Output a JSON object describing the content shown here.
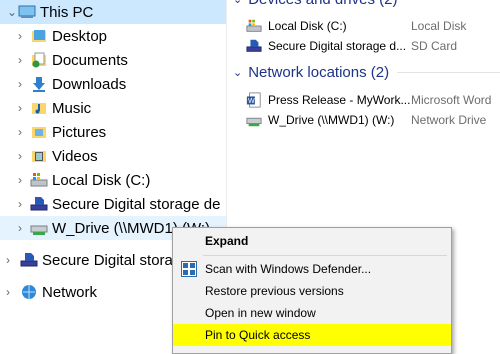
{
  "nav": {
    "items": [
      {
        "label": "This PC",
        "icon": "computer-icon"
      },
      {
        "label": "Desktop",
        "icon": "desktop-folder-icon"
      },
      {
        "label": "Documents",
        "icon": "documents-folder-icon"
      },
      {
        "label": "Downloads",
        "icon": "downloads-folder-icon"
      },
      {
        "label": "Music",
        "icon": "music-folder-icon"
      },
      {
        "label": "Pictures",
        "icon": "pictures-folder-icon"
      },
      {
        "label": "Videos",
        "icon": "videos-folder-icon"
      },
      {
        "label": "Local Disk (C:)",
        "icon": "local-disk-icon"
      },
      {
        "label": "Secure Digital storage de",
        "icon": "sd-card-icon"
      },
      {
        "label": "W_Drive (\\\\MWD1) (W:)",
        "icon": "network-drive-icon"
      },
      {
        "label": "Secure Digital stora",
        "icon": "sd-card-icon"
      },
      {
        "label": "Network",
        "icon": "network-icon"
      }
    ]
  },
  "content": {
    "devices_header": "Devices and drives (2)",
    "devices": [
      {
        "name": "Local Disk (C:)",
        "type": "Local Disk"
      },
      {
        "name": "Secure Digital storage d...",
        "type": "SD Card"
      }
    ],
    "network_header": "Network locations (2)",
    "network": [
      {
        "name": "Press Release - MyWork...",
        "type": "Microsoft Word"
      },
      {
        "name": "W_Drive (\\\\MWD1) (W:)",
        "type": "Network Drive"
      }
    ]
  },
  "context_menu": {
    "items": [
      {
        "label": "Expand"
      },
      {
        "label": "Scan with Windows Defender..."
      },
      {
        "label": "Restore previous versions"
      },
      {
        "label": "Open in new window"
      },
      {
        "label": "Pin to Quick access"
      }
    ],
    "highlight_color": "#ffff00"
  },
  "colors": {
    "selection": "#cce8ff",
    "group_header": "#1e3287"
  }
}
